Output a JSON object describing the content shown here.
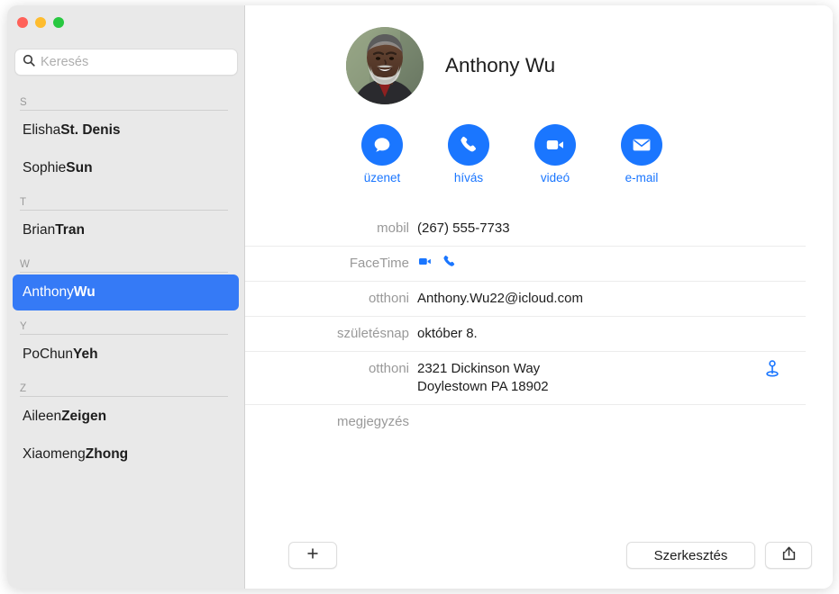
{
  "window": {
    "traffic_lights": [
      {
        "name": "close",
        "color": "#ff6159"
      },
      {
        "name": "minimize",
        "color": "#febc2e"
      },
      {
        "name": "zoom",
        "color": "#28c840"
      }
    ]
  },
  "sidebar": {
    "search": {
      "placeholder": "Keresés",
      "value": "",
      "icon": "search-icon"
    },
    "sections": [
      {
        "letter": "S",
        "contacts": [
          {
            "given": "Elisha ",
            "family": "St. Denis",
            "selected": false
          },
          {
            "given": "Sophie ",
            "family": "Sun",
            "selected": false
          }
        ]
      },
      {
        "letter": "T",
        "contacts": [
          {
            "given": "Brian ",
            "family": "Tran",
            "selected": false
          }
        ]
      },
      {
        "letter": "W",
        "contacts": [
          {
            "given": "Anthony ",
            "family": "Wu",
            "selected": true
          }
        ]
      },
      {
        "letter": "Y",
        "contacts": [
          {
            "given": "PoChun ",
            "family": "Yeh",
            "selected": false
          }
        ]
      },
      {
        "letter": "Z",
        "contacts": [
          {
            "given": "Aileen ",
            "family": "Zeigen",
            "selected": false
          },
          {
            "given": "Xiaomeng ",
            "family": "Zhong",
            "selected": false
          }
        ]
      }
    ],
    "selection_color": "#357af6",
    "background_color": "#e9e9e9"
  },
  "detail": {
    "avatar": "contact-photo",
    "name": "Anthony Wu",
    "accent_color": "#1a76ff",
    "actions": [
      {
        "label": "üzenet",
        "icon": "message-bubble-icon"
      },
      {
        "label": "hívás",
        "icon": "phone-icon"
      },
      {
        "label": "videó",
        "icon": "video-camera-icon"
      },
      {
        "label": "e-mail",
        "icon": "envelope-icon"
      }
    ],
    "fields": [
      {
        "label": "mobil",
        "value": "(267) 555-7733",
        "type": "text"
      },
      {
        "label": "FaceTime",
        "value": "",
        "type": "facetime",
        "icons": [
          "video-camera-icon",
          "phone-icon"
        ]
      },
      {
        "label": "otthoni",
        "value": "Anthony.Wu22@icloud.com",
        "type": "text"
      },
      {
        "label": "születésnap",
        "value": "október 8.",
        "type": "text"
      },
      {
        "label": "otthoni",
        "value": "2321 Dickinson Way",
        "value2": "Doylestown PA 18902",
        "type": "address",
        "icon": "map-pin-icon"
      },
      {
        "label": "megjegyzés",
        "value": "",
        "type": "text"
      }
    ]
  },
  "toolbar": {
    "add_label": "+",
    "add_icon": "plus-icon",
    "edit_label": "Szerkesztés",
    "share_icon": "share-icon"
  }
}
